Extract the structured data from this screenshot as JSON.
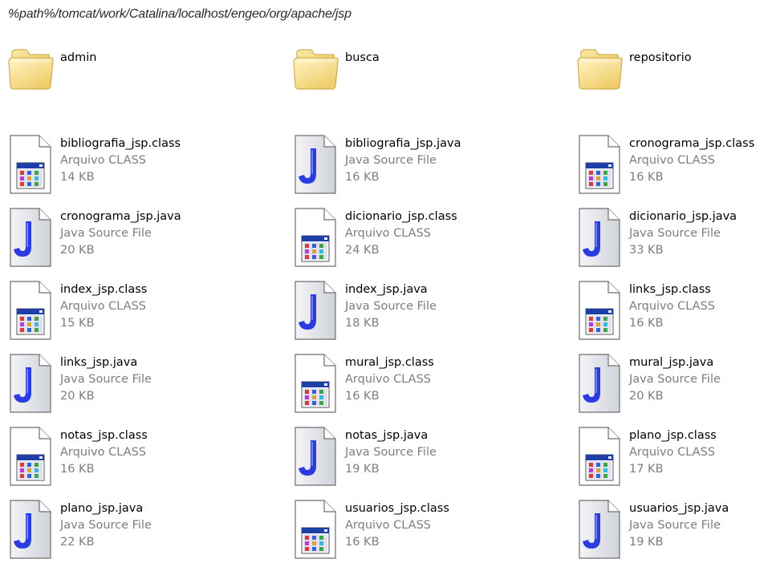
{
  "path": "%path%/tomcat/work/Catalina/localhost/engeo/org/apache/jsp",
  "items": [
    {
      "name": "admin",
      "kind": "folder",
      "type": "",
      "size": ""
    },
    {
      "name": "busca",
      "kind": "folder",
      "type": "",
      "size": ""
    },
    {
      "name": "repositorio",
      "kind": "folder",
      "type": "",
      "size": ""
    },
    {
      "name": "bibliografia_jsp.class",
      "kind": "class",
      "type": "Arquivo CLASS",
      "size": "14 KB"
    },
    {
      "name": "bibliografia_jsp.java",
      "kind": "java",
      "type": "Java Source File",
      "size": "16 KB"
    },
    {
      "name": "cronograma_jsp.class",
      "kind": "class",
      "type": "Arquivo CLASS",
      "size": "16 KB"
    },
    {
      "name": "cronograma_jsp.java",
      "kind": "java",
      "type": "Java Source File",
      "size": "20 KB"
    },
    {
      "name": "dicionario_jsp.class",
      "kind": "class",
      "type": "Arquivo CLASS",
      "size": "24 KB"
    },
    {
      "name": "dicionario_jsp.java",
      "kind": "java",
      "type": "Java Source File",
      "size": "33 KB"
    },
    {
      "name": "index_jsp.class",
      "kind": "class",
      "type": "Arquivo CLASS",
      "size": "15 KB"
    },
    {
      "name": "index_jsp.java",
      "kind": "java",
      "type": "Java Source File",
      "size": "18 KB"
    },
    {
      "name": "links_jsp.class",
      "kind": "class",
      "type": "Arquivo CLASS",
      "size": "16 KB"
    },
    {
      "name": "links_jsp.java",
      "kind": "java",
      "type": "Java Source File",
      "size": "20 KB"
    },
    {
      "name": "mural_jsp.class",
      "kind": "class",
      "type": "Arquivo CLASS",
      "size": "16 KB"
    },
    {
      "name": "mural_jsp.java",
      "kind": "java",
      "type": "Java Source File",
      "size": "20 KB"
    },
    {
      "name": "notas_jsp.class",
      "kind": "class",
      "type": "Arquivo CLASS",
      "size": "16 KB"
    },
    {
      "name": "notas_jsp.java",
      "kind": "java",
      "type": "Java Source File",
      "size": "19 KB"
    },
    {
      "name": "plano_jsp.class",
      "kind": "class",
      "type": "Arquivo CLASS",
      "size": "17 KB"
    },
    {
      "name": "plano_jsp.java",
      "kind": "java",
      "type": "Java Source File",
      "size": "22 KB"
    },
    {
      "name": "usuarios_jsp.class",
      "kind": "class",
      "type": "Arquivo CLASS",
      "size": "16 KB"
    },
    {
      "name": "usuarios_jsp.java",
      "kind": "java",
      "type": "Java Source File",
      "size": "19 KB"
    }
  ]
}
